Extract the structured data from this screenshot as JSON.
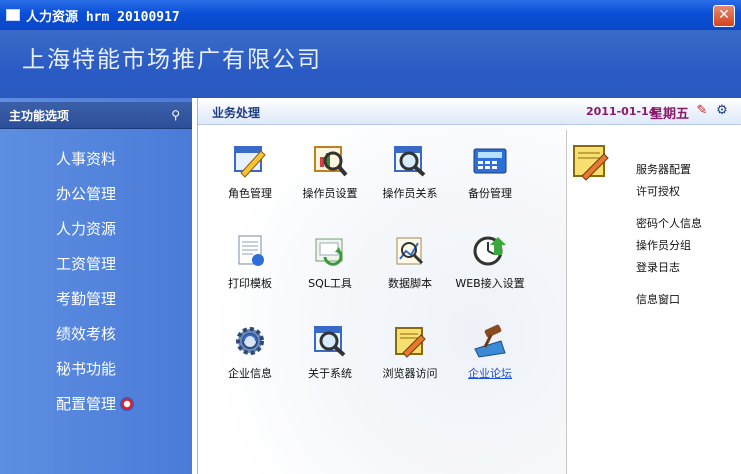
{
  "window": {
    "title": "人力资源 hrm 20100917"
  },
  "banner": {
    "company": "上海特能市场推广有限公司"
  },
  "sidebar": {
    "title": "主功能选项",
    "items": [
      {
        "label": "人事资料"
      },
      {
        "label": "办公管理"
      },
      {
        "label": "人力资源"
      },
      {
        "label": "工资管理"
      },
      {
        "label": "考勤管理"
      },
      {
        "label": "绩效考核"
      },
      {
        "label": "秘书功能"
      },
      {
        "label": "配置管理"
      }
    ]
  },
  "main": {
    "title": "业务处理",
    "date": "2011-01-14",
    "weekday": "星期五",
    "tiles": [
      {
        "label": "角色管理",
        "icon": "pencil-window-icon"
      },
      {
        "label": "操作员设置",
        "icon": "magnifier-chart-icon"
      },
      {
        "label": "操作员关系",
        "icon": "magnifier-window-icon"
      },
      {
        "label": "备份管理",
        "icon": "calculator-icon"
      },
      {
        "label": "打印模板",
        "icon": "document-icon"
      },
      {
        "label": "SQL工具",
        "icon": "sql-tool-icon"
      },
      {
        "label": "数据脚本",
        "icon": "script-magnifier-icon"
      },
      {
        "label": "WEB接入设置",
        "icon": "clock-arrow-icon"
      },
      {
        "label": "企业信息",
        "icon": "gear-icon"
      },
      {
        "label": "关于系统",
        "icon": "magnifier-window-icon"
      },
      {
        "label": "浏览器访问",
        "icon": "pencil-paper-icon"
      },
      {
        "label": "企业论坛",
        "icon": "gavel-icon"
      }
    ],
    "right_links": [
      {
        "label": "服务器配置"
      },
      {
        "label": "许可授权"
      },
      {
        "label": "密码个人信息"
      },
      {
        "label": "操作员分组"
      },
      {
        "label": "登录日志"
      },
      {
        "label": "信息窗口"
      }
    ]
  },
  "colors": {
    "titlebar": "#0a4fd6",
    "sidebar": "#5d8ee0",
    "accent_date": "#8a1a6a",
    "link": "#1a4fd6"
  }
}
